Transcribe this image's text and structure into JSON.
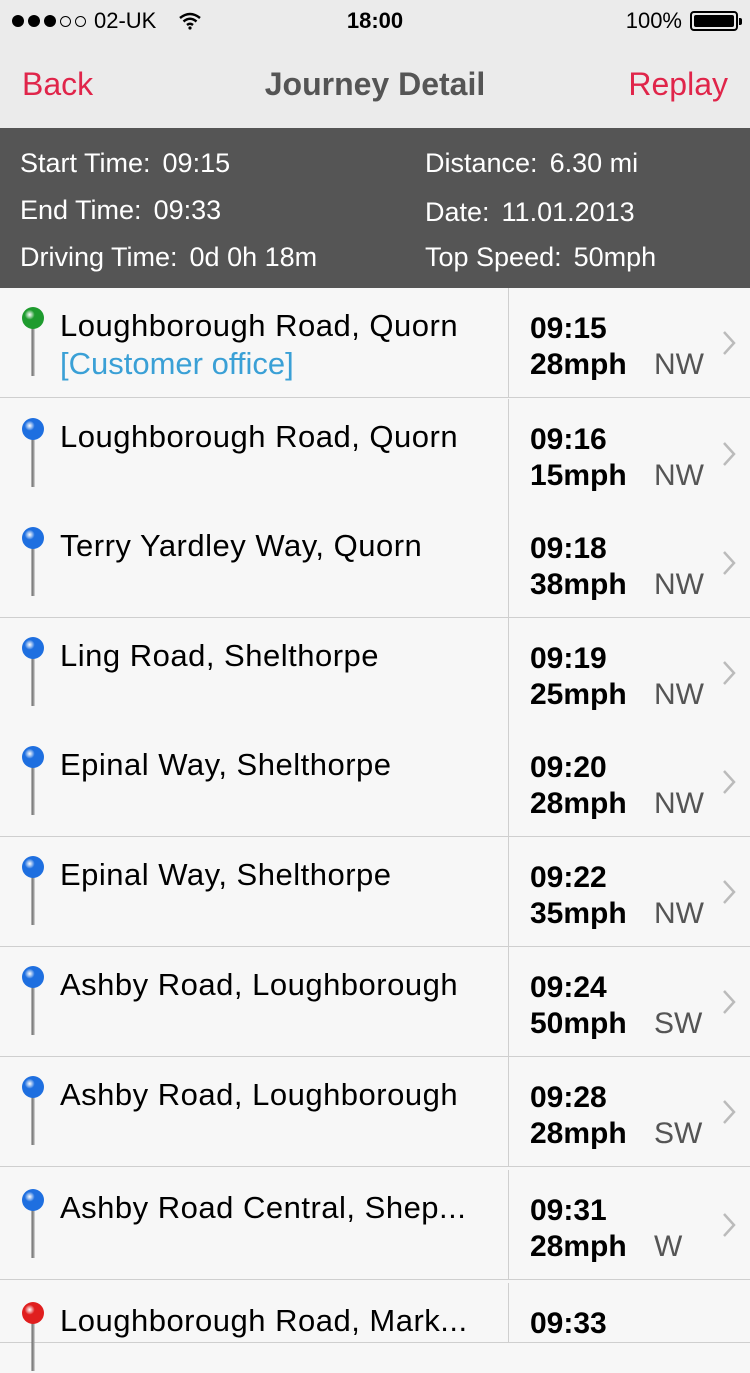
{
  "status_bar": {
    "carrier": "02-UK",
    "time": "18:00",
    "battery": "100%"
  },
  "nav": {
    "back": "Back",
    "title": "Journey Detail",
    "replay": "Replay"
  },
  "summary": {
    "start_label": "Start Time:",
    "start_value": "09:15",
    "end_label": "End Time:",
    "end_value": "09:33",
    "driving_label": "Driving Time:",
    "driving_value": "0d 0h 18m",
    "distance_label": "Distance:",
    "distance_value": "6.30 mi",
    "date_label": "Date:",
    "date_value": "11.01.2013",
    "speed_label": "Top Speed:",
    "speed_value": "50mph"
  },
  "colors": {
    "accent": "#e0254a",
    "tag": "#3aa0d6",
    "pin_start": "#1e9b2e",
    "pin_mid": "#1e6fe0",
    "pin_end": "#e01e1e"
  },
  "stops": [
    {
      "location": "Loughborough Road, Quorn",
      "tag": "[Customer office]",
      "time": "09:15",
      "speed": "28mph",
      "direction": "NW",
      "pin": "green-pin-icon"
    },
    {
      "location": "Loughborough Road, Quorn",
      "tag": "",
      "time": "09:16",
      "speed": "15mph",
      "direction": "NW",
      "pin": "blue-pin-icon"
    },
    {
      "location": "Terry Yardley Way, Quorn",
      "tag": "",
      "time": "09:18",
      "speed": "38mph",
      "direction": "NW",
      "pin": "blue-pin-icon"
    },
    {
      "location": "Ling Road, Shelthorpe",
      "tag": "",
      "time": "09:19",
      "speed": "25mph",
      "direction": "NW",
      "pin": "blue-pin-icon"
    },
    {
      "location": "Epinal Way, Shelthorpe",
      "tag": "",
      "time": "09:20",
      "speed": "28mph",
      "direction": "NW",
      "pin": "blue-pin-icon"
    },
    {
      "location": "Epinal Way, Shelthorpe",
      "tag": "",
      "time": "09:22",
      "speed": "35mph",
      "direction": "NW",
      "pin": "blue-pin-icon"
    },
    {
      "location": "Ashby Road, Loughborough",
      "tag": "",
      "time": "09:24",
      "speed": "50mph",
      "direction": "SW",
      "pin": "blue-pin-icon"
    },
    {
      "location": "Ashby Road, Loughborough",
      "tag": "",
      "time": "09:28",
      "speed": "28mph",
      "direction": "SW",
      "pin": "blue-pin-icon"
    },
    {
      "location": "Ashby Road Central, Shep...",
      "tag": "",
      "time": "09:31",
      "speed": "28mph",
      "direction": "W",
      "pin": "blue-pin-icon"
    },
    {
      "location": "Loughborough Road, Mark...",
      "tag": "",
      "time": "09:33",
      "speed": "",
      "direction": "",
      "pin": "red-pin-icon"
    }
  ]
}
